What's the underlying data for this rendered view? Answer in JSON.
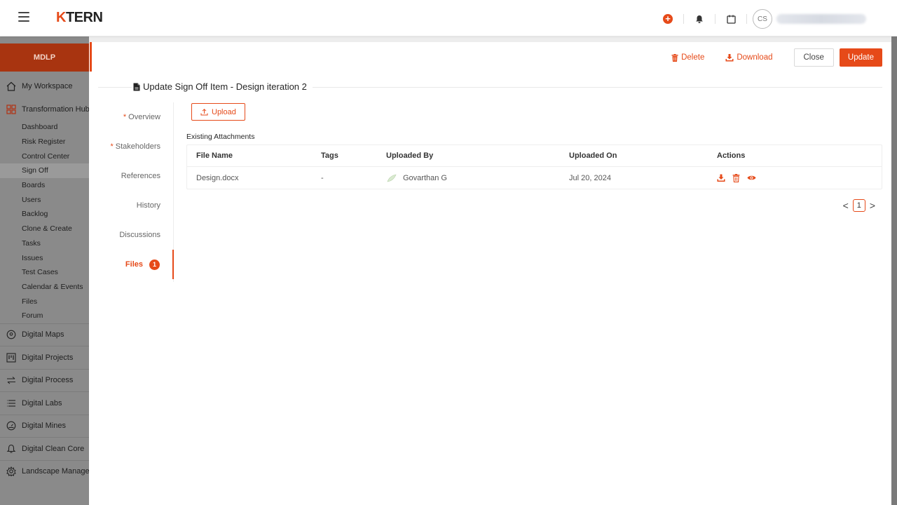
{
  "app": {
    "logo_mark": "K",
    "logo_text": "TERN",
    "avatar_initials": "CS"
  },
  "sidebar": {
    "project": "MDLP",
    "top_items": [
      {
        "label": "My Workspace",
        "icon": "home-icon"
      },
      {
        "label": "Transformation Hub",
        "icon": "grid-icon"
      }
    ],
    "sub_items": [
      {
        "label": "Dashboard"
      },
      {
        "label": "Risk Register"
      },
      {
        "label": "Control Center"
      },
      {
        "label": "Sign Off",
        "active": true
      },
      {
        "label": "Boards"
      },
      {
        "label": "Users"
      },
      {
        "label": "Backlog"
      },
      {
        "label": "Clone & Create"
      },
      {
        "label": "Tasks"
      },
      {
        "label": "Issues"
      },
      {
        "label": "Test Cases"
      },
      {
        "label": "Calendar & Events"
      },
      {
        "label": "Files"
      },
      {
        "label": "Forum"
      }
    ],
    "groups": [
      {
        "label": "Digital Maps",
        "icon": "map-pin-icon"
      },
      {
        "label": "Digital Projects",
        "icon": "kanban-icon"
      },
      {
        "label": "Digital Process",
        "icon": "arrows-icon"
      },
      {
        "label": "Digital Labs",
        "icon": "list-icon"
      },
      {
        "label": "Digital Mines",
        "icon": "gauge-icon"
      },
      {
        "label": "Digital Clean Core",
        "icon": "bell-outline-icon"
      },
      {
        "label": "Landscape Managen",
        "icon": "gear-icon"
      }
    ]
  },
  "toolbar": {
    "delete_label": "Delete",
    "download_label": "Download",
    "close_label": "Close",
    "update_label": "Update"
  },
  "page": {
    "title": "Update Sign Off Item - Design iteration 2"
  },
  "tabs": [
    {
      "label": "Overview",
      "required": true
    },
    {
      "label": "Stakeholders",
      "required": true
    },
    {
      "label": "References",
      "required": false
    },
    {
      "label": "History",
      "required": false
    },
    {
      "label": "Discussions",
      "required": false
    },
    {
      "label": "Files",
      "required": false,
      "active": true,
      "badge": "1"
    }
  ],
  "files": {
    "upload_label": "Upload",
    "section_label": "Existing Attachments",
    "columns": [
      "File Name",
      "Tags",
      "Uploaded By",
      "Uploaded On",
      "Actions"
    ],
    "rows": [
      {
        "file_name": "Design.docx",
        "tags": "-",
        "uploaded_by": "Govarthan G",
        "uploaded_on": "Jul 20, 2024"
      }
    ]
  },
  "pagination": {
    "prev": "<",
    "current": "1",
    "next": ">"
  },
  "colors": {
    "accent": "#e64a19",
    "sidebar_header": "#a83410"
  }
}
